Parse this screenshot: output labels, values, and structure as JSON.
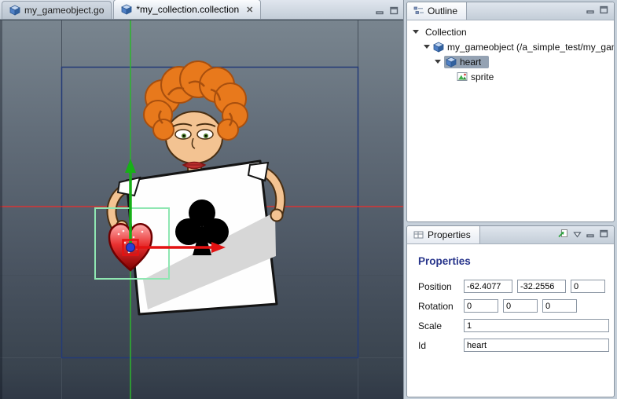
{
  "icons": {
    "close": "✕"
  },
  "editor": {
    "tabs": [
      {
        "label": "my_gameobject.go"
      },
      {
        "label": "*my_collection.collection"
      }
    ]
  },
  "outline_panel": {
    "tab_label": "Outline",
    "tree": [
      {
        "label": "Collection"
      },
      {
        "label": "my_gameobject (/a_simple_test/my_gam"
      },
      {
        "label": "heart"
      },
      {
        "label": "sprite"
      }
    ]
  },
  "properties_panel": {
    "tab_label": "Properties",
    "title": "Properties",
    "rows": {
      "position": {
        "label": "Position",
        "values": [
          "-62.4077",
          "-32.2556",
          "0"
        ]
      },
      "rotation": {
        "label": "Rotation",
        "values": [
          "0",
          "0",
          "0"
        ]
      },
      "scale": {
        "label": "Scale",
        "value": "1"
      },
      "id": {
        "label": "Id",
        "value": "heart"
      }
    }
  },
  "scene": {
    "selected_object_id": "heart",
    "axis_colors": {
      "x": "#e31212",
      "y": "#17b017"
    },
    "selection_box_color": "#8fe6b2"
  }
}
